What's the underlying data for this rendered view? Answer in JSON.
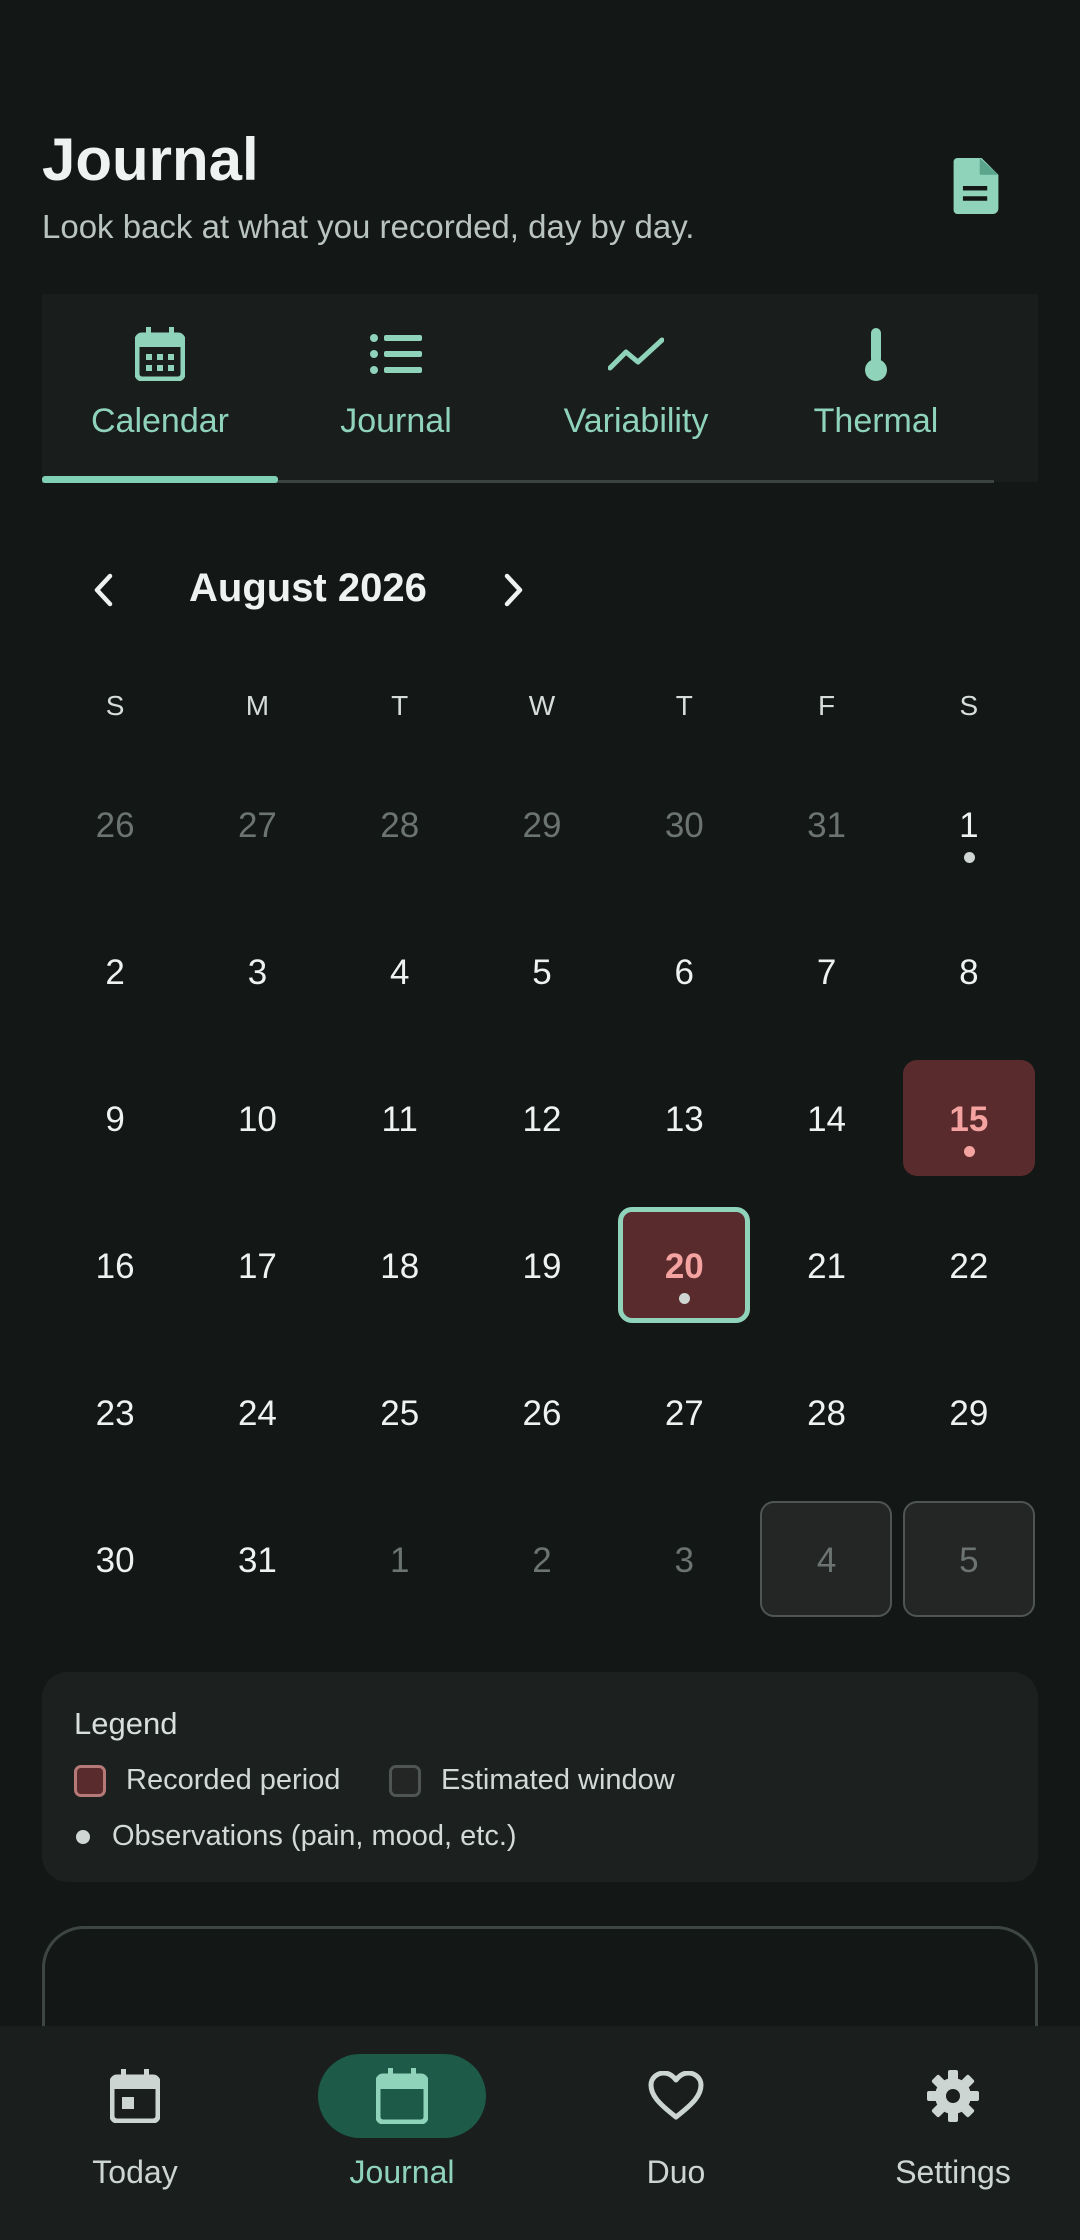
{
  "header": {
    "title": "Journal",
    "subtitle": "Look back at what you recorded, day by day.",
    "export_icon": "document-icon"
  },
  "tabs": [
    {
      "label": "Calendar",
      "icon": "calendar-icon",
      "active": true
    },
    {
      "label": "Journal",
      "icon": "list-icon",
      "active": false
    },
    {
      "label": "Variability",
      "icon": "trend-icon",
      "active": false
    },
    {
      "label": "Thermal",
      "icon": "thermometer-icon",
      "active": false
    }
  ],
  "calendar": {
    "month_label": "August 2026",
    "weekdays": [
      "S",
      "M",
      "T",
      "W",
      "T",
      "F",
      "S"
    ],
    "weeks": [
      [
        {
          "d": "26",
          "other": true
        },
        {
          "d": "27",
          "other": true
        },
        {
          "d": "28",
          "other": true
        },
        {
          "d": "29",
          "other": true
        },
        {
          "d": "30",
          "other": true
        },
        {
          "d": "31",
          "other": true
        },
        {
          "d": "1",
          "dot": true
        }
      ],
      [
        {
          "d": "2"
        },
        {
          "d": "3"
        },
        {
          "d": "4"
        },
        {
          "d": "5"
        },
        {
          "d": "6"
        },
        {
          "d": "7"
        },
        {
          "d": "8"
        }
      ],
      [
        {
          "d": "9"
        },
        {
          "d": "10"
        },
        {
          "d": "11"
        },
        {
          "d": "12"
        },
        {
          "d": "13"
        },
        {
          "d": "14"
        },
        {
          "d": "15",
          "recorded": true,
          "dot": true
        }
      ],
      [
        {
          "d": "16"
        },
        {
          "d": "17"
        },
        {
          "d": "18"
        },
        {
          "d": "19"
        },
        {
          "d": "20",
          "recorded": true,
          "today": true,
          "dot": true
        },
        {
          "d": "21"
        },
        {
          "d": "22"
        }
      ],
      [
        {
          "d": "23"
        },
        {
          "d": "24"
        },
        {
          "d": "25"
        },
        {
          "d": "26"
        },
        {
          "d": "27"
        },
        {
          "d": "28"
        },
        {
          "d": "29"
        }
      ],
      [
        {
          "d": "30"
        },
        {
          "d": "31"
        },
        {
          "d": "1",
          "other": true
        },
        {
          "d": "2",
          "other": true
        },
        {
          "d": "3",
          "other": true
        },
        {
          "d": "4",
          "other": true,
          "estimated": true
        },
        {
          "d": "5",
          "other": true,
          "estimated": true
        }
      ]
    ]
  },
  "legend": {
    "title": "Legend",
    "recorded_label": "Recorded period",
    "estimated_label": "Estimated window",
    "observations_label": "Observations (pain, mood, etc.)"
  },
  "bottom_nav": [
    {
      "label": "Today",
      "icon": "calendar-today-icon",
      "active": false
    },
    {
      "label": "Journal",
      "icon": "calendar-blank-icon",
      "active": true
    },
    {
      "label": "Duo",
      "icon": "heart-icon",
      "active": false
    },
    {
      "label": "Settings",
      "icon": "gear-icon",
      "active": false
    }
  ],
  "colors": {
    "accent": "#8fd3bb",
    "recorded": "#5a2b2d",
    "recorded_text": "#f4a3a0",
    "background": "#131716"
  }
}
